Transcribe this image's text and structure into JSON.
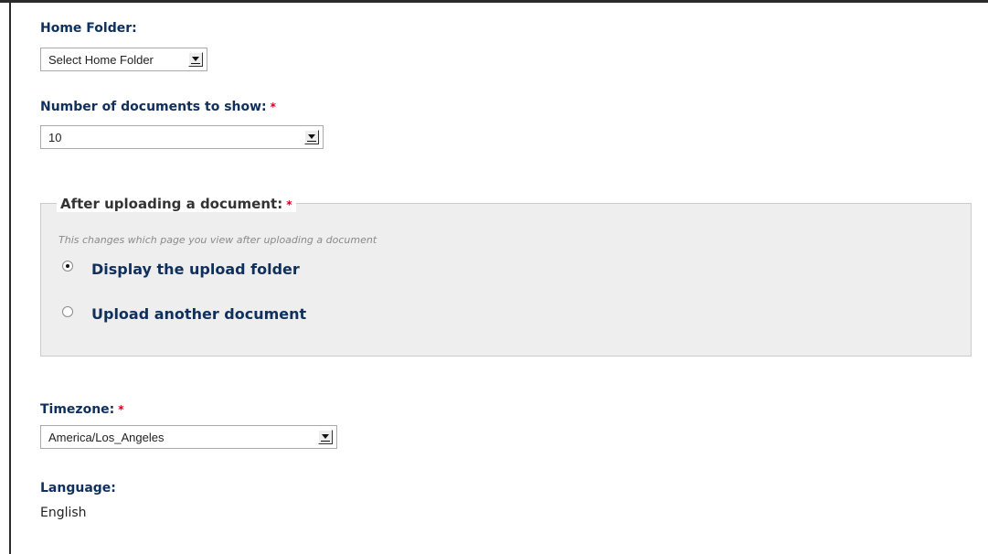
{
  "home_folder": {
    "label": "Home Folder:",
    "select_value": "Select Home Folder"
  },
  "num_docs": {
    "label": "Number of documents to show:",
    "required_mark": "*",
    "select_value": "10"
  },
  "after_upload": {
    "legend": "After uploading a document:",
    "required_mark": "*",
    "hint": "This changes which page you view after uploading a document",
    "options": [
      {
        "label": "Display the upload folder",
        "checked": true
      },
      {
        "label": "Upload another document",
        "checked": false
      }
    ]
  },
  "timezone": {
    "label": "Timezone:",
    "required_mark": "*",
    "select_value": "America/Los_Angeles"
  },
  "language": {
    "label": "Language:",
    "value": "English"
  }
}
